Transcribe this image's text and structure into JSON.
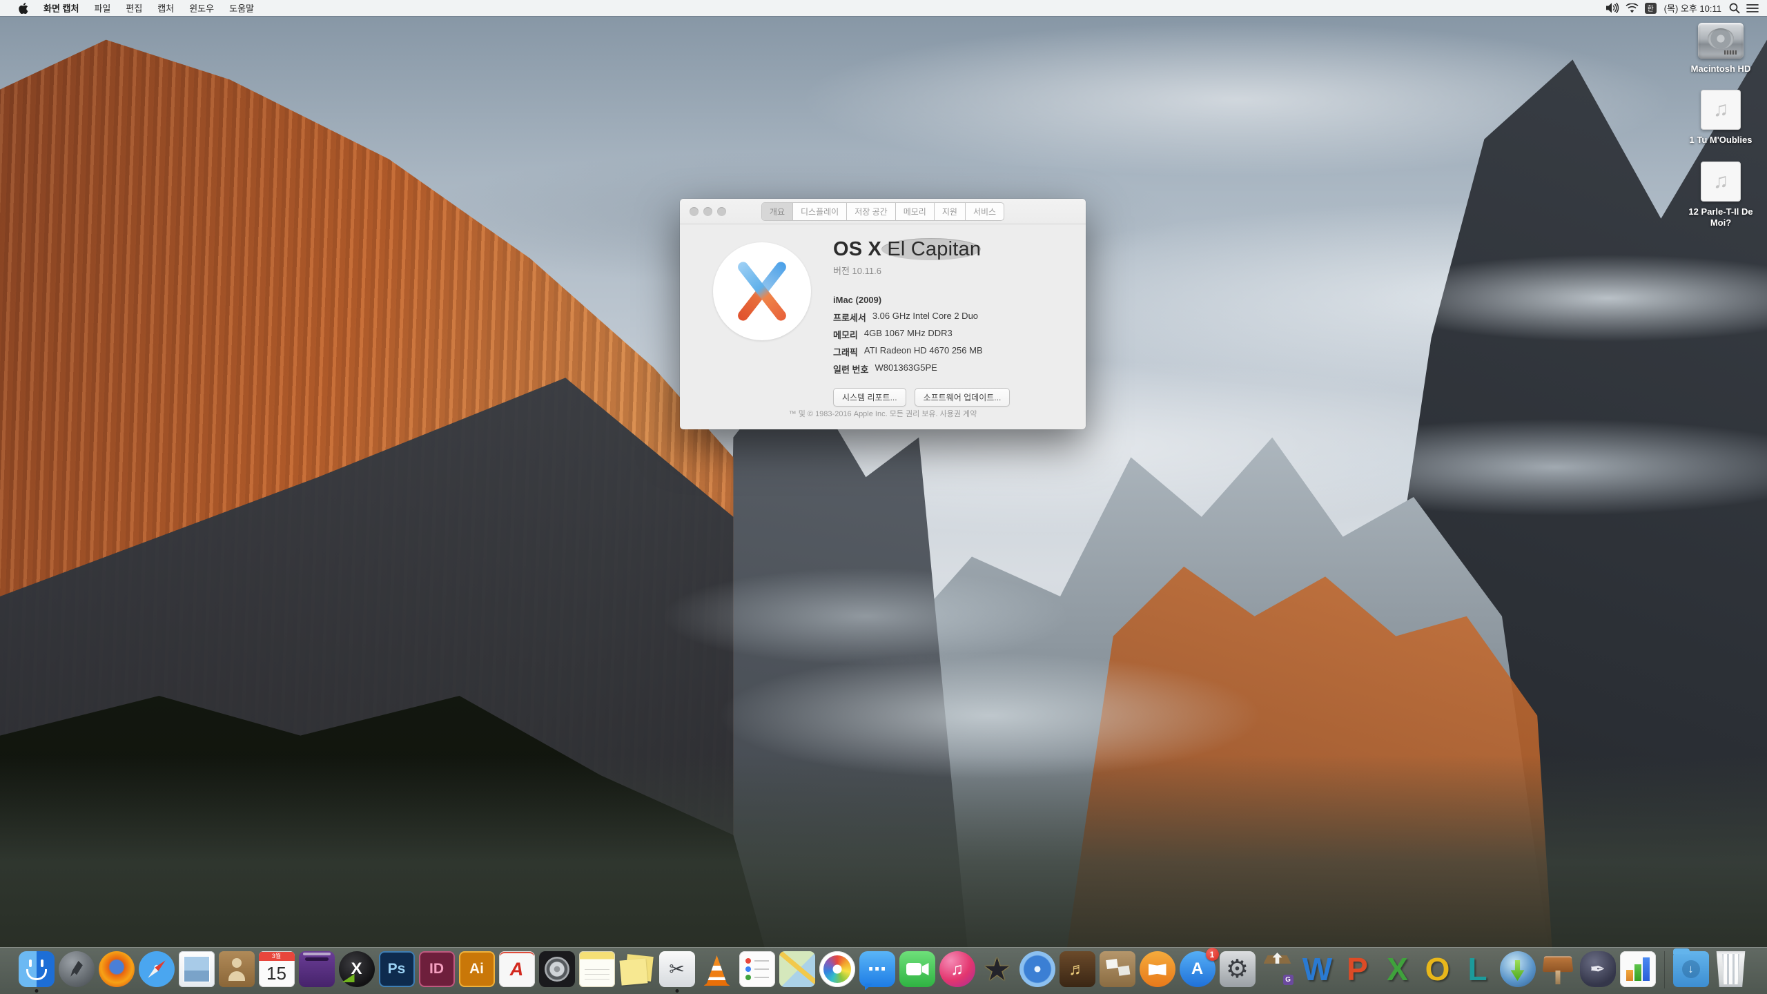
{
  "menubar": {
    "app_menu": "화면 캡처",
    "menus": [
      "파일",
      "편집",
      "캡처",
      "윈도우",
      "도움말"
    ],
    "status": {
      "volume_icon": "volume-icon",
      "wifi_icon": "wifi-icon",
      "input_source": "한",
      "clock": "(목) 오후 10:11",
      "spotlight_icon": "search-icon",
      "notification_center_icon": "list-icon"
    }
  },
  "about_window": {
    "tabs": [
      "개요",
      "디스플레이",
      "저장 공간",
      "메모리",
      "지원",
      "서비스"
    ],
    "active_tab": "개요",
    "title_os": "OS X",
    "title_name": " El Capitan",
    "version": "버전 10.11.6",
    "model": "iMac (2009)",
    "specs": [
      {
        "label": "프로세서",
        "value": "3.06 GHz Intel Core 2 Duo"
      },
      {
        "label": "메모리",
        "value": "4GB 1067 MHz DDR3"
      },
      {
        "label": "그래픽",
        "value": "ATI Radeon HD 4670 256 MB"
      },
      {
        "label": "일련 번호",
        "value": "W801363G5PE"
      }
    ],
    "buttons": [
      "시스템 리포트...",
      "소프트웨어 업데이트..."
    ],
    "copyright": "™ 및 © 1983-2016 Apple Inc. 모든 권리 보유. 사용권 계약"
  },
  "desktop_icons": [
    {
      "label": "Macintosh HD",
      "type": "hard-drive"
    },
    {
      "label": "1 Tu M'Oublies",
      "type": "audio-file",
      "glyph": "♫"
    },
    {
      "label": "12 Parle-T-Il De Moi?",
      "type": "audio-file",
      "glyph": "♫"
    }
  ],
  "dock": {
    "items": [
      "finder",
      "launchpad",
      "firefox",
      "safari",
      "mail",
      "contacts",
      "calendar",
      "toast",
      "xee",
      "photoshop",
      "indesign",
      "illustrator",
      "acrobat",
      "logic",
      "notes",
      "stickies",
      "grab",
      "vlc",
      "reminders",
      "maps",
      "photos",
      "messages",
      "facetime",
      "itunes",
      "imovie",
      "idvd",
      "garageband",
      "iphoto",
      "ibooks",
      "app-store",
      "system-preferences",
      "stuffit-expander",
      "word",
      "powerpoint",
      "excel",
      "outlook",
      "lync",
      "download-manager",
      "keynote",
      "pages",
      "numbers",
      "downloads-folder",
      "trash"
    ],
    "running_apps": [
      "finder",
      "grab"
    ],
    "texts": {
      "calendar_month": "3월",
      "calendar_day": "15",
      "photoshop": "Ps",
      "indesign": "ID",
      "illustrator": "Ai",
      "acrobat": "A",
      "xee": "X",
      "grab_glyph": "✂",
      "itunes_glyph": "♫",
      "imovie_glyph": "★",
      "garageband_glyph": "♬",
      "appstore": "A",
      "appstore_badge": "1",
      "sysprefs_glyph": "⚙",
      "stuffit_badge": "G",
      "word": "W",
      "powerpoint": "P",
      "excel": "X",
      "outlook": "O",
      "lync": "L",
      "pages_glyph": "✒",
      "messages_glyph": "⋯",
      "downloads_arrow": "↓"
    }
  },
  "colors": {
    "menubar_bg": "#f6f7f7",
    "dock_bg": "rgba(110,120,114,0.64)",
    "badge_red": "#d92a20",
    "window_bg": "#ededed",
    "accent_orange_cliff": "#c2652f"
  }
}
